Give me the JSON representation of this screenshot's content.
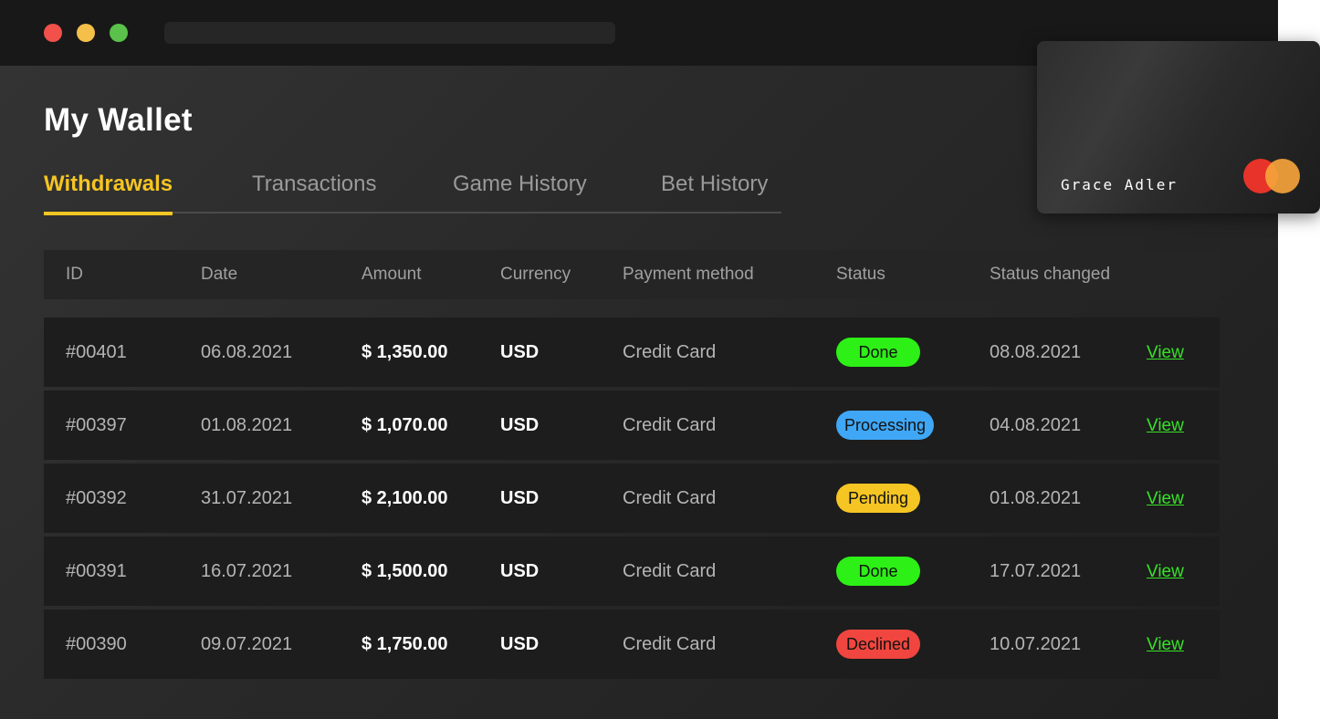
{
  "page": {
    "title": "My Wallet"
  },
  "tabs": [
    {
      "label": "Withdrawals",
      "active": true
    },
    {
      "label": "Transactions",
      "active": false
    },
    {
      "label": "Game History",
      "active": false
    },
    {
      "label": "Bet History",
      "active": false
    }
  ],
  "table": {
    "columns": [
      "ID",
      "Date",
      "Amount",
      "Currency",
      "Payment method",
      "Status",
      "Status changed"
    ],
    "rows": [
      {
        "id": "#00401",
        "date": "06.08.2021",
        "amount": "$ 1,350.00",
        "currency": "USD",
        "method": "Credit Card",
        "status": "Done",
        "status_color": "#2df016",
        "changed": "08.08.2021",
        "action": "View"
      },
      {
        "id": "#00397",
        "date": "01.08.2021",
        "amount": "$ 1,070.00",
        "currency": "USD",
        "method": "Credit Card",
        "status": "Processing",
        "status_color": "#3fa7f5",
        "changed": "04.08.2021",
        "action": "View"
      },
      {
        "id": "#00392",
        "date": "31.07.2021",
        "amount": "$ 2,100.00",
        "currency": "USD",
        "method": "Credit Card",
        "status": "Pending",
        "status_color": "#f5c523",
        "changed": "01.08.2021",
        "action": "View"
      },
      {
        "id": "#00391",
        "date": "16.07.2021",
        "amount": "$ 1,500.00",
        "currency": "USD",
        "method": "Credit Card",
        "status": "Done",
        "status_color": "#2df016",
        "changed": "17.07.2021",
        "action": "View"
      },
      {
        "id": "#00390",
        "date": "09.07.2021",
        "amount": "$ 1,750.00",
        "currency": "USD",
        "method": "Credit Card",
        "status": "Declined",
        "status_color": "#f0463f",
        "changed": "10.07.2021",
        "action": "View"
      }
    ]
  },
  "card": {
    "holder": "Grace Adler",
    "brand_icon": "mastercard-logo-icon"
  },
  "window_controls": {
    "close_color": "#f2504b",
    "minimize_color": "#f5c04a",
    "maximize_color": "#5ac24a"
  },
  "colors": {
    "accent": "#f5c523",
    "link": "#37e228"
  }
}
